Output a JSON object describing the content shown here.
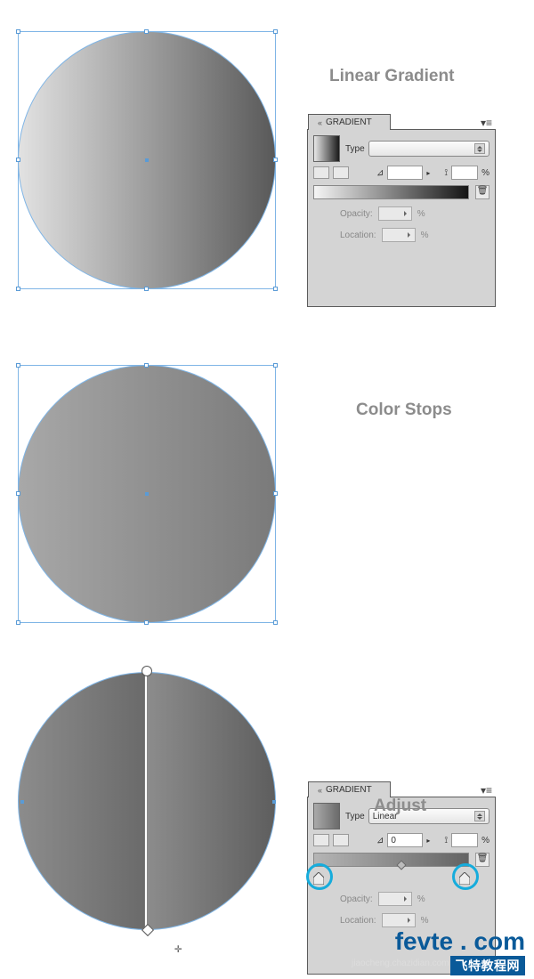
{
  "section1": {
    "title": "Linear Gradient"
  },
  "section2": {
    "title": "Color Stops"
  },
  "section3": {
    "title": "Adjust"
  },
  "panel": {
    "title": "GRADIENT",
    "type_label": "Type",
    "type_value1": "",
    "type_value2": "Linear",
    "angle_value": "0",
    "percent": "%",
    "opacity_label": "Opacity:",
    "location_label": "Location:",
    "trash_glyph": "🗑"
  },
  "watermark": {
    "brand": "fevte",
    "dot": ".",
    "tld": "com",
    "sub": "飞特教程网",
    "faint": "jiaocheng.chazidian.com"
  }
}
